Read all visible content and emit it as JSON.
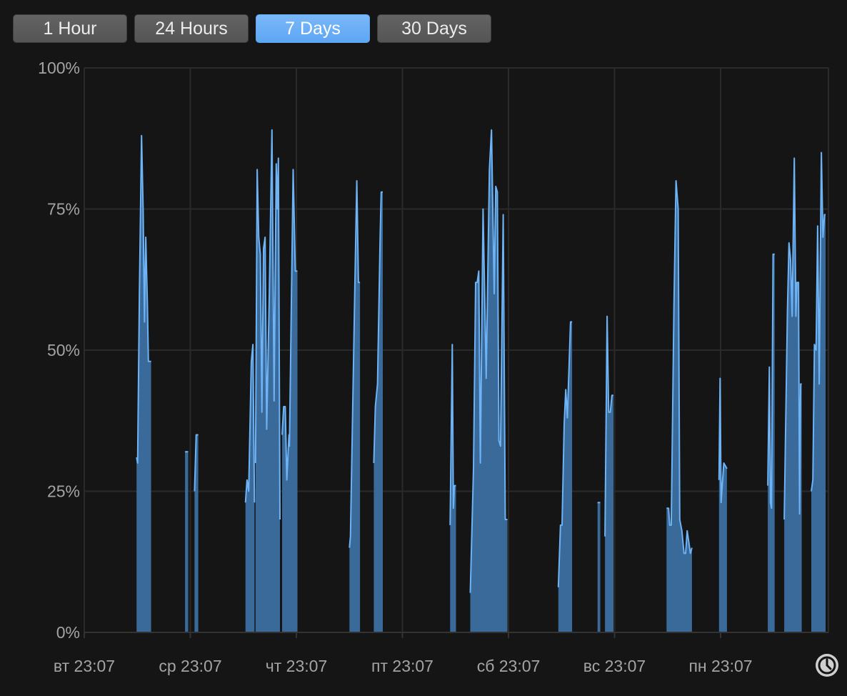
{
  "range_tabs": [
    {
      "label": "1 Hour",
      "selected": false
    },
    {
      "label": "24 Hours",
      "selected": false
    },
    {
      "label": "7 Days",
      "selected": true
    },
    {
      "label": "30 Days",
      "selected": false
    }
  ],
  "colors": {
    "line": "#6db3f5",
    "fill": "#3a6a9a",
    "grid": "#2a2a2a",
    "axis": "#333333",
    "accent": "#5ea6f4"
  },
  "icons": {
    "time_button": "clock-icon"
  },
  "chart_data": {
    "type": "area",
    "title": "",
    "xlabel": "",
    "ylabel": "",
    "ylim": [
      0,
      100
    ],
    "yticks": [
      0,
      25,
      50,
      75,
      100
    ],
    "ytick_labels": [
      "0%",
      "25%",
      "50%",
      "75%",
      "100%"
    ],
    "xlim": [
      0,
      7
    ],
    "xticks": [
      0,
      1,
      2,
      3,
      4,
      5,
      6
    ],
    "xtick_labels": [
      "вт 23:07",
      "ср 23:07",
      "чт 23:07",
      "пт 23:07",
      "сб 23:07",
      "вс 23:07",
      "пн 23:07"
    ],
    "x_unit": "days after вт 23:07",
    "grid": true,
    "series": [
      {
        "segments": [
          [
            [
              0.493,
              31
            ],
            [
              0.503,
              30
            ],
            [
              0.52,
              60
            ],
            [
              0.54,
              88
            ],
            [
              0.555,
              75
            ],
            [
              0.568,
              55
            ],
            [
              0.58,
              70
            ],
            [
              0.595,
              58
            ],
            [
              0.605,
              48
            ],
            [
              0.63,
              48
            ]
          ],
          [
            [
              0.95,
              32
            ],
            [
              0.98,
              32
            ]
          ],
          [
            [
              1.04,
              25
            ],
            [
              1.055,
              35
            ],
            [
              1.075,
              35
            ]
          ],
          [
            [
              1.52,
              23
            ],
            [
              1.535,
              27
            ],
            [
              1.55,
              25
            ],
            [
              1.575,
              48
            ],
            [
              1.59,
              51
            ],
            [
              1.605,
              23
            ]
          ],
          [
            [
              1.615,
              30
            ],
            [
              1.63,
              82
            ],
            [
              1.645,
              70
            ],
            [
              1.66,
              67
            ],
            [
              1.675,
              39
            ],
            [
              1.69,
              68
            ],
            [
              1.705,
              70
            ],
            [
              1.72,
              36
            ],
            [
              1.745,
              60
            ],
            [
              1.77,
              89
            ],
            [
              1.79,
              41
            ],
            [
              1.81,
              83
            ],
            [
              1.82,
              75
            ],
            [
              1.83,
              84
            ],
            [
              1.845,
              20
            ]
          ],
          [
            [
              1.865,
              35
            ],
            [
              1.88,
              40
            ],
            [
              1.895,
              40
            ],
            [
              1.91,
              27
            ],
            [
              1.93,
              35
            ],
            [
              1.935,
              33
            ],
            [
              1.97,
              82
            ],
            [
              1.99,
              64
            ],
            [
              2.01,
              64
            ]
          ],
          [
            [
              2.5,
              15
            ],
            [
              2.51,
              17
            ],
            [
              2.55,
              60
            ],
            [
              2.57,
              80
            ],
            [
              2.585,
              62
            ],
            [
              2.6,
              62
            ]
          ],
          [
            [
              2.73,
              30
            ],
            [
              2.745,
              40
            ],
            [
              2.765,
              44
            ],
            [
              2.79,
              70
            ],
            [
              2.8,
              78
            ],
            [
              2.815,
              78
            ]
          ],
          [
            [
              3.45,
              19
            ],
            [
              3.47,
              51
            ],
            [
              3.48,
              22
            ],
            [
              3.49,
              26
            ],
            [
              3.505,
              26
            ]
          ],
          [
            [
              3.64,
              7
            ],
            [
              3.67,
              29
            ],
            [
              3.69,
              62
            ],
            [
              3.705,
              62
            ],
            [
              3.72,
              64
            ],
            [
              3.735,
              30
            ],
            [
              3.76,
              75
            ],
            [
              3.79,
              45
            ],
            [
              3.82,
              82
            ],
            [
              3.84,
              89
            ],
            [
              3.865,
              60
            ],
            [
              3.88,
              79
            ],
            [
              3.895,
              78
            ],
            [
              3.91,
              34
            ],
            [
              3.925,
              33
            ],
            [
              3.95,
              74
            ],
            [
              3.97,
              20
            ],
            [
              3.99,
              20
            ]
          ],
          [
            [
              4.47,
              8
            ],
            [
              4.49,
              19
            ],
            [
              4.505,
              19
            ],
            [
              4.525,
              37
            ],
            [
              4.54,
              43
            ],
            [
              4.555,
              38
            ],
            [
              4.585,
              55
            ],
            [
              4.6,
              55
            ]
          ],
          [
            [
              4.84,
              23
            ],
            [
              4.865,
              23
            ]
          ],
          [
            [
              4.91,
              17
            ],
            [
              4.93,
              56
            ],
            [
              4.945,
              39
            ],
            [
              4.96,
              39
            ],
            [
              4.975,
              42
            ],
            [
              4.99,
              42
            ]
          ],
          [
            [
              5.49,
              22
            ],
            [
              5.51,
              22
            ],
            [
              5.52,
              19
            ],
            [
              5.535,
              19
            ],
            [
              5.56,
              58
            ],
            [
              5.58,
              80
            ],
            [
              5.6,
              75
            ],
            [
              5.615,
              20
            ],
            [
              5.635,
              18
            ],
            [
              5.655,
              14
            ],
            [
              5.67,
              14
            ],
            [
              5.685,
              18
            ],
            [
              5.7,
              16
            ],
            [
              5.715,
              14
            ],
            [
              5.73,
              15
            ]
          ],
          [
            [
              5.985,
              27
            ],
            [
              5.995,
              45
            ],
            [
              6.005,
              23
            ],
            [
              6.03,
              30
            ],
            [
              6.06,
              29
            ]
          ],
          [
            [
              6.445,
              26
            ],
            [
              6.46,
              47
            ],
            [
              6.47,
              23
            ],
            [
              6.48,
              22
            ],
            [
              6.495,
              67
            ],
            [
              6.51,
              67
            ]
          ],
          [
            [
              6.6,
              20
            ],
            [
              6.63,
              57
            ],
            [
              6.645,
              69
            ],
            [
              6.66,
              66
            ],
            [
              6.675,
              56
            ],
            [
              6.695,
              84
            ],
            [
              6.71,
              56
            ],
            [
              6.72,
              62
            ],
            [
              6.735,
              62
            ],
            [
              6.745,
              21
            ],
            [
              6.755,
              44
            ],
            [
              6.765,
              44
            ]
          ],
          [
            [
              6.855,
              25
            ],
            [
              6.87,
              27
            ],
            [
              6.885,
              51
            ],
            [
              6.9,
              50
            ],
            [
              6.915,
              72
            ],
            [
              6.93,
              44
            ],
            [
              6.95,
              85
            ],
            [
              6.965,
              70
            ],
            [
              6.98,
              74
            ],
            [
              6.99,
              74
            ]
          ]
        ]
      }
    ]
  }
}
